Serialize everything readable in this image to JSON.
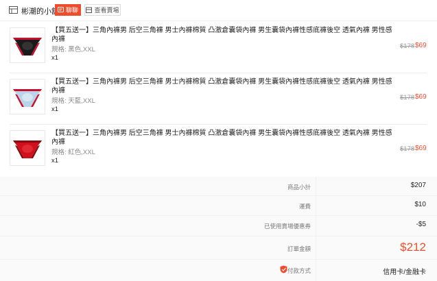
{
  "shop": {
    "name": "彬潮的小舖",
    "chat_label": "聊聊",
    "view_shop_label": "查看賣場"
  },
  "items": [
    {
      "title": "【買五送一】三角內褲男 后空三角褲 男士內褲棉質 凸激倉囊袋內褲 男生囊袋內褲性感底褲後空 透氣內褲 男性感內褲",
      "variation": "規格: 黑色,XXL",
      "quantity": "x1",
      "original_price": "$178",
      "price": "$69",
      "color": "#1a1a1a",
      "accent": "#c8102e"
    },
    {
      "title": "【買五送一】三角內褲男 后空三角褲 男士內褲棉質 凸激倉囊袋內褲 男生囊袋內褲性感底褲後空 透氣內褲 男性感內褲",
      "variation": "規格: 天藍,XXL",
      "quantity": "x1",
      "original_price": "$178",
      "price": "$69",
      "color": "#b9d4e8",
      "accent": "#c8102e"
    },
    {
      "title": "【買五送一】三角內褲男 后空三角褲 男士內褲棉質 凸激倉囊袋內褲 男生囊袋內褲性感底褲後空 透氣內褲 男性感內褲",
      "variation": "規格: 紅色,XXL",
      "quantity": "x1",
      "original_price": "$178",
      "price": "$69",
      "color": "#d0101c",
      "accent": "#8b0a12"
    }
  ],
  "summary": {
    "subtotal_label": "商品小計",
    "subtotal_value": "$207",
    "shipping_label": "運費",
    "shipping_value": "$10",
    "coupon_label": "已使用賣場優惠券",
    "coupon_value": "-$5",
    "total_label": "訂單金額",
    "total_value": "$212",
    "payment_label": "付款方式",
    "payment_value": "信用卡/金融卡"
  },
  "colors": {
    "accent": "#ee4d2d"
  }
}
